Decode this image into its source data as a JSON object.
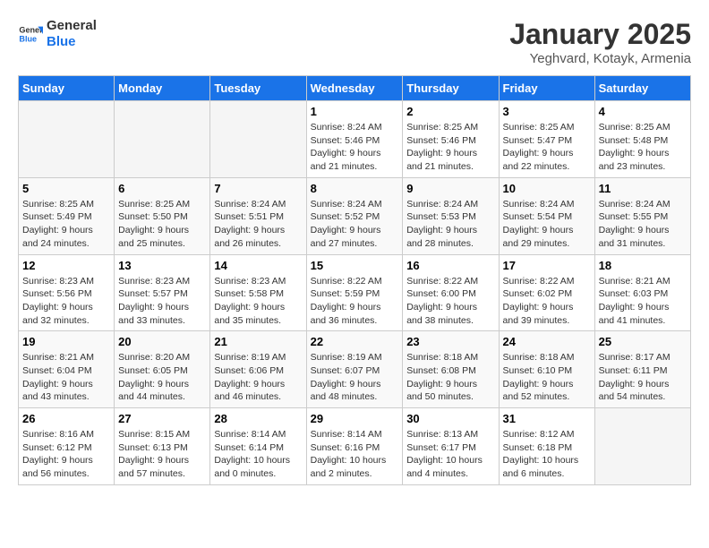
{
  "logo": {
    "line1": "General",
    "line2": "Blue"
  },
  "title": "January 2025",
  "subtitle": "Yeghvard, Kotayk, Armenia",
  "headers": [
    "Sunday",
    "Monday",
    "Tuesday",
    "Wednesday",
    "Thursday",
    "Friday",
    "Saturday"
  ],
  "weeks": [
    [
      {
        "num": "",
        "info": ""
      },
      {
        "num": "",
        "info": ""
      },
      {
        "num": "",
        "info": ""
      },
      {
        "num": "1",
        "info": "Sunrise: 8:24 AM\nSunset: 5:46 PM\nDaylight: 9 hours\nand 21 minutes."
      },
      {
        "num": "2",
        "info": "Sunrise: 8:25 AM\nSunset: 5:46 PM\nDaylight: 9 hours\nand 21 minutes."
      },
      {
        "num": "3",
        "info": "Sunrise: 8:25 AM\nSunset: 5:47 PM\nDaylight: 9 hours\nand 22 minutes."
      },
      {
        "num": "4",
        "info": "Sunrise: 8:25 AM\nSunset: 5:48 PM\nDaylight: 9 hours\nand 23 minutes."
      }
    ],
    [
      {
        "num": "5",
        "info": "Sunrise: 8:25 AM\nSunset: 5:49 PM\nDaylight: 9 hours\nand 24 minutes."
      },
      {
        "num": "6",
        "info": "Sunrise: 8:25 AM\nSunset: 5:50 PM\nDaylight: 9 hours\nand 25 minutes."
      },
      {
        "num": "7",
        "info": "Sunrise: 8:24 AM\nSunset: 5:51 PM\nDaylight: 9 hours\nand 26 minutes."
      },
      {
        "num": "8",
        "info": "Sunrise: 8:24 AM\nSunset: 5:52 PM\nDaylight: 9 hours\nand 27 minutes."
      },
      {
        "num": "9",
        "info": "Sunrise: 8:24 AM\nSunset: 5:53 PM\nDaylight: 9 hours\nand 28 minutes."
      },
      {
        "num": "10",
        "info": "Sunrise: 8:24 AM\nSunset: 5:54 PM\nDaylight: 9 hours\nand 29 minutes."
      },
      {
        "num": "11",
        "info": "Sunrise: 8:24 AM\nSunset: 5:55 PM\nDaylight: 9 hours\nand 31 minutes."
      }
    ],
    [
      {
        "num": "12",
        "info": "Sunrise: 8:23 AM\nSunset: 5:56 PM\nDaylight: 9 hours\nand 32 minutes."
      },
      {
        "num": "13",
        "info": "Sunrise: 8:23 AM\nSunset: 5:57 PM\nDaylight: 9 hours\nand 33 minutes."
      },
      {
        "num": "14",
        "info": "Sunrise: 8:23 AM\nSunset: 5:58 PM\nDaylight: 9 hours\nand 35 minutes."
      },
      {
        "num": "15",
        "info": "Sunrise: 8:22 AM\nSunset: 5:59 PM\nDaylight: 9 hours\nand 36 minutes."
      },
      {
        "num": "16",
        "info": "Sunrise: 8:22 AM\nSunset: 6:00 PM\nDaylight: 9 hours\nand 38 minutes."
      },
      {
        "num": "17",
        "info": "Sunrise: 8:22 AM\nSunset: 6:02 PM\nDaylight: 9 hours\nand 39 minutes."
      },
      {
        "num": "18",
        "info": "Sunrise: 8:21 AM\nSunset: 6:03 PM\nDaylight: 9 hours\nand 41 minutes."
      }
    ],
    [
      {
        "num": "19",
        "info": "Sunrise: 8:21 AM\nSunset: 6:04 PM\nDaylight: 9 hours\nand 43 minutes."
      },
      {
        "num": "20",
        "info": "Sunrise: 8:20 AM\nSunset: 6:05 PM\nDaylight: 9 hours\nand 44 minutes."
      },
      {
        "num": "21",
        "info": "Sunrise: 8:19 AM\nSunset: 6:06 PM\nDaylight: 9 hours\nand 46 minutes."
      },
      {
        "num": "22",
        "info": "Sunrise: 8:19 AM\nSunset: 6:07 PM\nDaylight: 9 hours\nand 48 minutes."
      },
      {
        "num": "23",
        "info": "Sunrise: 8:18 AM\nSunset: 6:08 PM\nDaylight: 9 hours\nand 50 minutes."
      },
      {
        "num": "24",
        "info": "Sunrise: 8:18 AM\nSunset: 6:10 PM\nDaylight: 9 hours\nand 52 minutes."
      },
      {
        "num": "25",
        "info": "Sunrise: 8:17 AM\nSunset: 6:11 PM\nDaylight: 9 hours\nand 54 minutes."
      }
    ],
    [
      {
        "num": "26",
        "info": "Sunrise: 8:16 AM\nSunset: 6:12 PM\nDaylight: 9 hours\nand 56 minutes."
      },
      {
        "num": "27",
        "info": "Sunrise: 8:15 AM\nSunset: 6:13 PM\nDaylight: 9 hours\nand 57 minutes."
      },
      {
        "num": "28",
        "info": "Sunrise: 8:14 AM\nSunset: 6:14 PM\nDaylight: 10 hours\nand 0 minutes."
      },
      {
        "num": "29",
        "info": "Sunrise: 8:14 AM\nSunset: 6:16 PM\nDaylight: 10 hours\nand 2 minutes."
      },
      {
        "num": "30",
        "info": "Sunrise: 8:13 AM\nSunset: 6:17 PM\nDaylight: 10 hours\nand 4 minutes."
      },
      {
        "num": "31",
        "info": "Sunrise: 8:12 AM\nSunset: 6:18 PM\nDaylight: 10 hours\nand 6 minutes."
      },
      {
        "num": "",
        "info": ""
      }
    ]
  ]
}
